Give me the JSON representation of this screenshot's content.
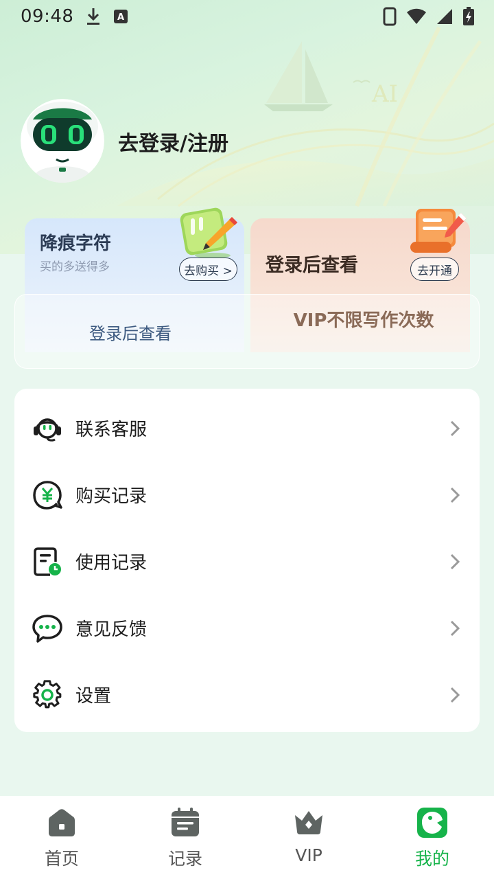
{
  "status_bar": {
    "time": "09:48"
  },
  "profile": {
    "login_text": "去登录/注册"
  },
  "promo": {
    "left": {
      "title": "降痕字符",
      "subtitle": "买的多送得多",
      "button": "去购买 >",
      "value": "登录后查看"
    },
    "right": {
      "title": "登录后查看",
      "button": "去开通",
      "value": "VIP不限写作次数"
    }
  },
  "menu": {
    "items": [
      {
        "label": "联系客服",
        "icon": "headset-icon"
      },
      {
        "label": "购买记录",
        "icon": "yuan-coin-icon"
      },
      {
        "label": "使用记录",
        "icon": "usage-record-icon"
      },
      {
        "label": "意见反馈",
        "icon": "feedback-bubble-icon"
      },
      {
        "label": "设置",
        "icon": "gear-icon"
      }
    ]
  },
  "bottom_nav": {
    "items": [
      {
        "label": "首页",
        "icon": "home-icon"
      },
      {
        "label": "记录",
        "icon": "calendar-icon"
      },
      {
        "label": "VIP",
        "icon": "crown-icon"
      },
      {
        "label": "我的",
        "icon": "profile-logo-icon",
        "active": true
      }
    ]
  },
  "colors": {
    "accent": "#16b34a",
    "icon_dark": "#1e1e1e",
    "nav_inactive": "#5e6462"
  }
}
